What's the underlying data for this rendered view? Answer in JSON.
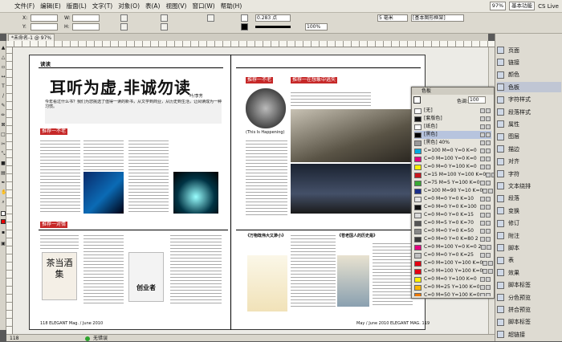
{
  "menubar": {
    "items": [
      "文件(F)",
      "编辑(E)",
      "版面(L)",
      "文字(T)",
      "对象(O)",
      "表(A)",
      "视图(V)",
      "窗口(W)",
      "帮助(H)"
    ],
    "zoom": "97%",
    "workspace": "基本功能",
    "cs_live": "CS Live"
  },
  "ctrlbar": {
    "x_label": "X:",
    "y_label": "Y:",
    "w_label": "W:",
    "h_label": "H:",
    "stroke_weight": "0.283 点",
    "percent": "100%",
    "mm_value": "5 毫米",
    "frame_style": "[基本图形框架]"
  },
  "tab": {
    "label": "*未命名-1 @ 97%"
  },
  "page": {
    "left_section": "读读",
    "headline": "耳听为虚,非诚勿读",
    "byline": "叶/李芳",
    "intro": "今年看过什么书？我们为您挑选了值得一读的新书，从文学到商业，从历史到生活，让阅读成为一种习惯。",
    "sec1": "推荐一不老",
    "sec2": "推荐一对情",
    "right_sec_a": "推荐一不老",
    "right_sec_b": "推荐一在想象中逃失",
    "book_title_a": "(This Is Happening)",
    "book_title_b": "《万物既伟大又渺小》",
    "book_title_c": "《苍老国人的历史是》",
    "footer_left": "118  ELEGANT Mag. / June 2010",
    "footer_right": "May / June 2010 ELEGANT MAG. 119",
    "cover_text_a": "茶当酒集",
    "cover_text_b": "创业者"
  },
  "status": {
    "page": "118",
    "errors": "无错误"
  },
  "swatches": {
    "panel_title": "色板",
    "tint_label": "色调:",
    "tint_value": "100",
    "items": [
      {
        "name": "[无]",
        "color": "#ffffff"
      },
      {
        "name": "[套版色]",
        "color": "#111111"
      },
      {
        "name": "[纸色]",
        "color": "#ffffff"
      },
      {
        "name": "[黑色]",
        "color": "#000000"
      },
      {
        "name": "[黑色] 40%",
        "color": "#999999"
      },
      {
        "name": "C=100 M=0 Y=0 K=0",
        "color": "#00a9e0"
      },
      {
        "name": "C=0 M=100 Y=0 K=0",
        "color": "#e4007f"
      },
      {
        "name": "C=0 M=0 Y=100 K=0",
        "color": "#fff100"
      },
      {
        "name": "C=15 M=100 Y=100 K=0",
        "color": "#c8161d"
      },
      {
        "name": "C=75 M=5 Y=100 K=0",
        "color": "#3aa935"
      },
      {
        "name": "C=100 M=90 Y=10 K=0",
        "color": "#1b2f8a"
      },
      {
        "name": "C=0 M=0 Y=0 K=10",
        "color": "#e6e6e6"
      },
      {
        "name": "C=0 M=0 Y=0 K=100",
        "color": "#111111"
      },
      {
        "name": "C=0 M=0 Y=0 K=15",
        "color": "#dadada"
      },
      {
        "name": "C=0 M=5 Y=0 K=70",
        "color": "#555555"
      },
      {
        "name": "C=0 M=0 Y=0 K=50",
        "color": "#888888"
      },
      {
        "name": "C=0 M=0 Y=0 K=80 2",
        "color": "#3a3a3a"
      },
      {
        "name": "C=0 M=100 Y=0 K=0 2",
        "color": "#e4007f"
      },
      {
        "name": "C=0 M=0 Y=0 K=25",
        "color": "#c0c0c0"
      },
      {
        "name": "C=0 M=100 Y=100 K=0",
        "color": "#e60012"
      },
      {
        "name": "C=0 M=100 Y=100 K=0",
        "color": "#e60012"
      },
      {
        "name": "C=0 M=0 Y=100 K=0",
        "color": "#fff100"
      },
      {
        "name": "C=0 M=25 Y=100 K=0",
        "color": "#f8b500"
      },
      {
        "name": "C=0 M=50 Y=100 K=0",
        "color": "#ee7800"
      },
      {
        "name": "C=0 M=0 Y=0 K=0",
        "color": "#ffffff"
      }
    ]
  },
  "dock": {
    "items": [
      "页面",
      "链接",
      "颜色",
      "色板",
      "字符样式",
      "段落样式",
      "属性",
      "图层",
      "描边",
      "对齐",
      "字符",
      "文本绕排",
      "段落",
      "变换",
      "修订",
      "附注",
      "脚本",
      "表",
      "效果",
      "脚本标签",
      "分色预览",
      "拼合预览",
      "脚本标签",
      "超链接"
    ]
  }
}
